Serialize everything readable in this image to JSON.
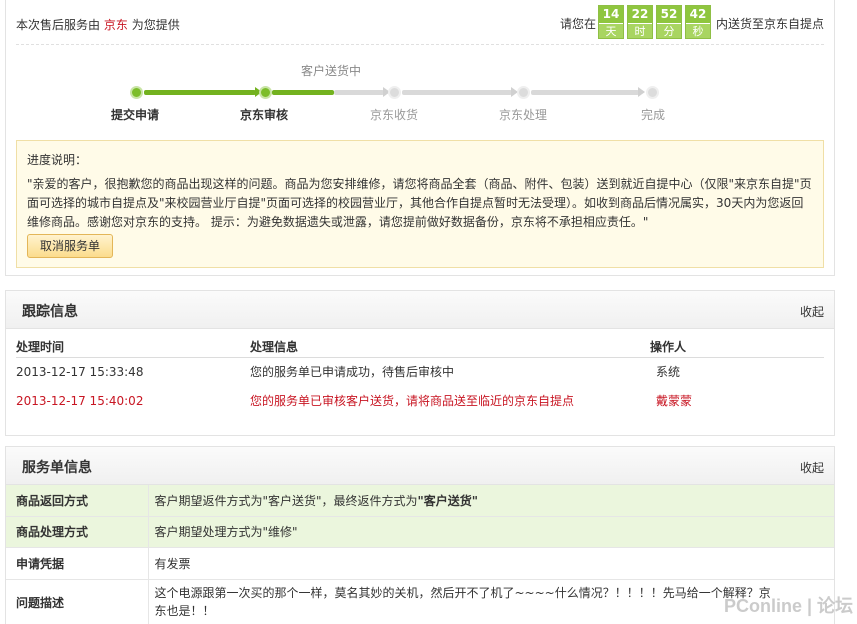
{
  "header": {
    "provider_prefix": "本次售后服务由",
    "provider_brand": "京东",
    "provider_suffix": "为您提供",
    "countdown_prefix": "请您在",
    "countdown_suffix": "内送货至京东自提点",
    "countdown": [
      {
        "num": "14",
        "unit": "天"
      },
      {
        "num": "22",
        "unit": "时"
      },
      {
        "num": "52",
        "unit": "分"
      },
      {
        "num": "42",
        "unit": "秒"
      }
    ]
  },
  "progress": {
    "current_label": "客户送货中",
    "steps": [
      {
        "label": "提交申请",
        "state": "done"
      },
      {
        "label": "京东审核",
        "state": "done"
      },
      {
        "label": "京东收货",
        "state": "todo"
      },
      {
        "label": "京东处理",
        "state": "todo"
      },
      {
        "label": "完成",
        "state": "todo"
      }
    ]
  },
  "notice": {
    "title": "进度说明：",
    "body": "\"亲爱的客户，很抱歉您的商品出现这样的问题。商品为您安排维修，请您将商品全套（商品、附件、包装）送到就近自提中心（仅限\"来京东自提\"页面可选择的城市自提点及\"来校园营业厅自提\"页面可选择的校园营业厅，其他合作自提点暂时无法受理）。如收到商品后情况属实，30天内为您返回维修商品。感谢您对京东的支持。 提示：为避免数据遗失或泄露，请您提前做好数据备份，京东将不承担相应责任。\"",
    "cancel_button": "取消服务单"
  },
  "tracking": {
    "title": "跟踪信息",
    "collapse": "收起",
    "columns": [
      "处理时间",
      "处理信息",
      "操作人"
    ],
    "rows": [
      {
        "time": "2013-12-17 15:33:48",
        "info": "您的服务单已申请成功，待售后审核中",
        "operator": "系统"
      },
      {
        "time": "2013-12-17 15:40:02",
        "info": "您的服务单已审核客户送货，请将商品送至临近的京东自提点",
        "operator": "戴蒙蒙"
      }
    ]
  },
  "service": {
    "title": "服务单信息",
    "collapse": "收起",
    "rows": [
      {
        "key": "商品返回方式",
        "value_prefix": "客户期望返件方式为\"客户送货\"，最终返件方式为",
        "value_strong": "\"客户送货\""
      },
      {
        "key": "商品处理方式",
        "value_prefix": "客户期望处理方式为\"维修\"",
        "value_strong": ""
      },
      {
        "key": "申请凭据",
        "value_prefix": "有发票",
        "value_strong": ""
      },
      {
        "key": "问题描述",
        "value_prefix": "这个电源跟第一次买的那个一样，莫名其妙的关机，然后开不了机了~~~~什么情况？！！！！先马给一个解释？京东也是！！",
        "value_strong": ""
      }
    ]
  },
  "watermark": "PConline | 论坛",
  "colors": {
    "brand_red": "#c81623",
    "progress_green": "#73b21f",
    "notice_bg": "#fffbe8",
    "highlight_row": "#ebf6dd"
  }
}
